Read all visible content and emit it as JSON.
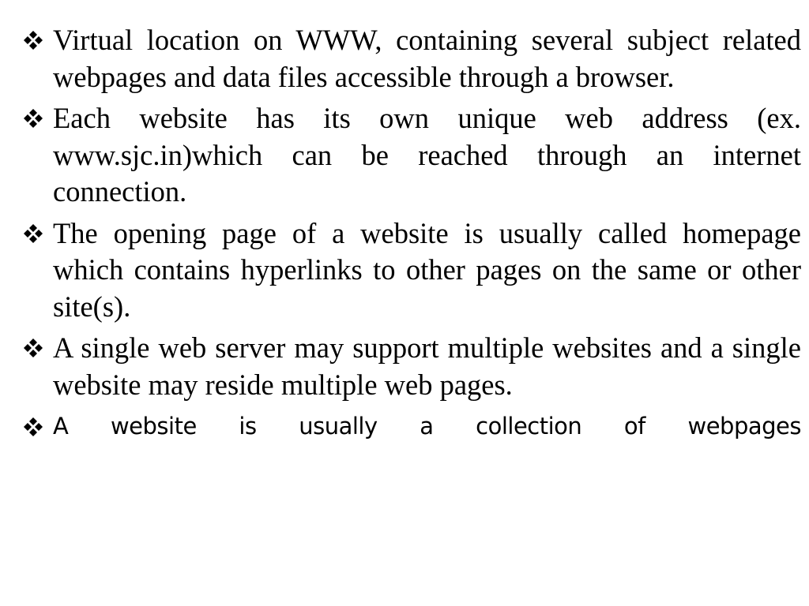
{
  "bullet_icon": "diamond-cluster-icon",
  "bullets": [
    {
      "text": "Virtual location on WWW, containing several subject related webpages and data files accessible through a browser."
    },
    {
      "text": "Each website has its own unique web address (ex. www.sjc.in)which can be reached through an internet connection."
    },
    {
      "text": "The opening page of a website is usually called homepage which contains hyperlinks to other pages on the same or other site(s)."
    },
    {
      "text": "A single web server may support multiple websites and a single website may reside multiple web pages."
    },
    {
      "text": "A website is usually a collection of webpages"
    }
  ]
}
